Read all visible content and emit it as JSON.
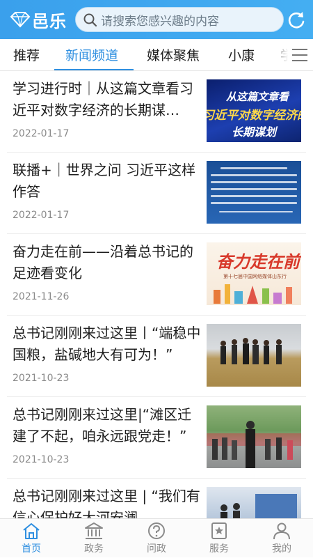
{
  "header": {
    "app_name": "邑乐",
    "search_placeholder": "请搜索您感兴趣的内容",
    "logo_icon": "diamond-logo-icon",
    "refresh_icon": "refresh-icon"
  },
  "tabs": [
    {
      "label": "推荐",
      "active": false
    },
    {
      "label": "新闻频道",
      "active": true
    },
    {
      "label": "媒体聚焦",
      "active": false
    },
    {
      "label": "小康",
      "active": false
    },
    {
      "label": "学",
      "active": false
    }
  ],
  "menu_icon": "menu-icon",
  "articles": [
    {
      "title": "学习进行时｜从这篇文章看习近平对数字经济的长期谋…",
      "date": "2022-01-17",
      "thumb_text": [
        "从这篇文章看",
        "习近平对数字经济的",
        "长期谋划"
      ]
    },
    {
      "title": "联播+｜世界之问 习近平这样作答",
      "date": "2022-01-17"
    },
    {
      "title": "奋力走在前——沿着总书记的足迹看变化",
      "date": "2021-11-26",
      "thumb_text": [
        "奋力走在前",
        "第十七届中国网络媒体山东行"
      ]
    },
    {
      "title": "总书记刚刚来过这里丨“端稳中国粮，盐碱地大有可为！”",
      "date": "2021-10-23"
    },
    {
      "title": "总书记刚刚来过这里|“滩区迁建了不起，咱永远跟党走！”",
      "date": "2021-10-23"
    },
    {
      "title": "总书记刚刚来过这里 | “我们有信心保护好大河安澜",
      "date": ""
    }
  ],
  "bottom_nav": [
    {
      "label": "首页",
      "icon": "home-icon",
      "active": true
    },
    {
      "label": "政务",
      "icon": "government-building-icon",
      "active": false
    },
    {
      "label": "问政",
      "icon": "question-circle-icon",
      "active": false
    },
    {
      "label": "服务",
      "icon": "star-bookmark-icon",
      "active": false
    },
    {
      "label": "我的",
      "icon": "user-icon",
      "active": false
    }
  ],
  "colors": {
    "brand": "#3aa0ec",
    "active_tab": "#2f8fe0",
    "text": "#1e1e1e",
    "date": "#8a8a8a"
  }
}
